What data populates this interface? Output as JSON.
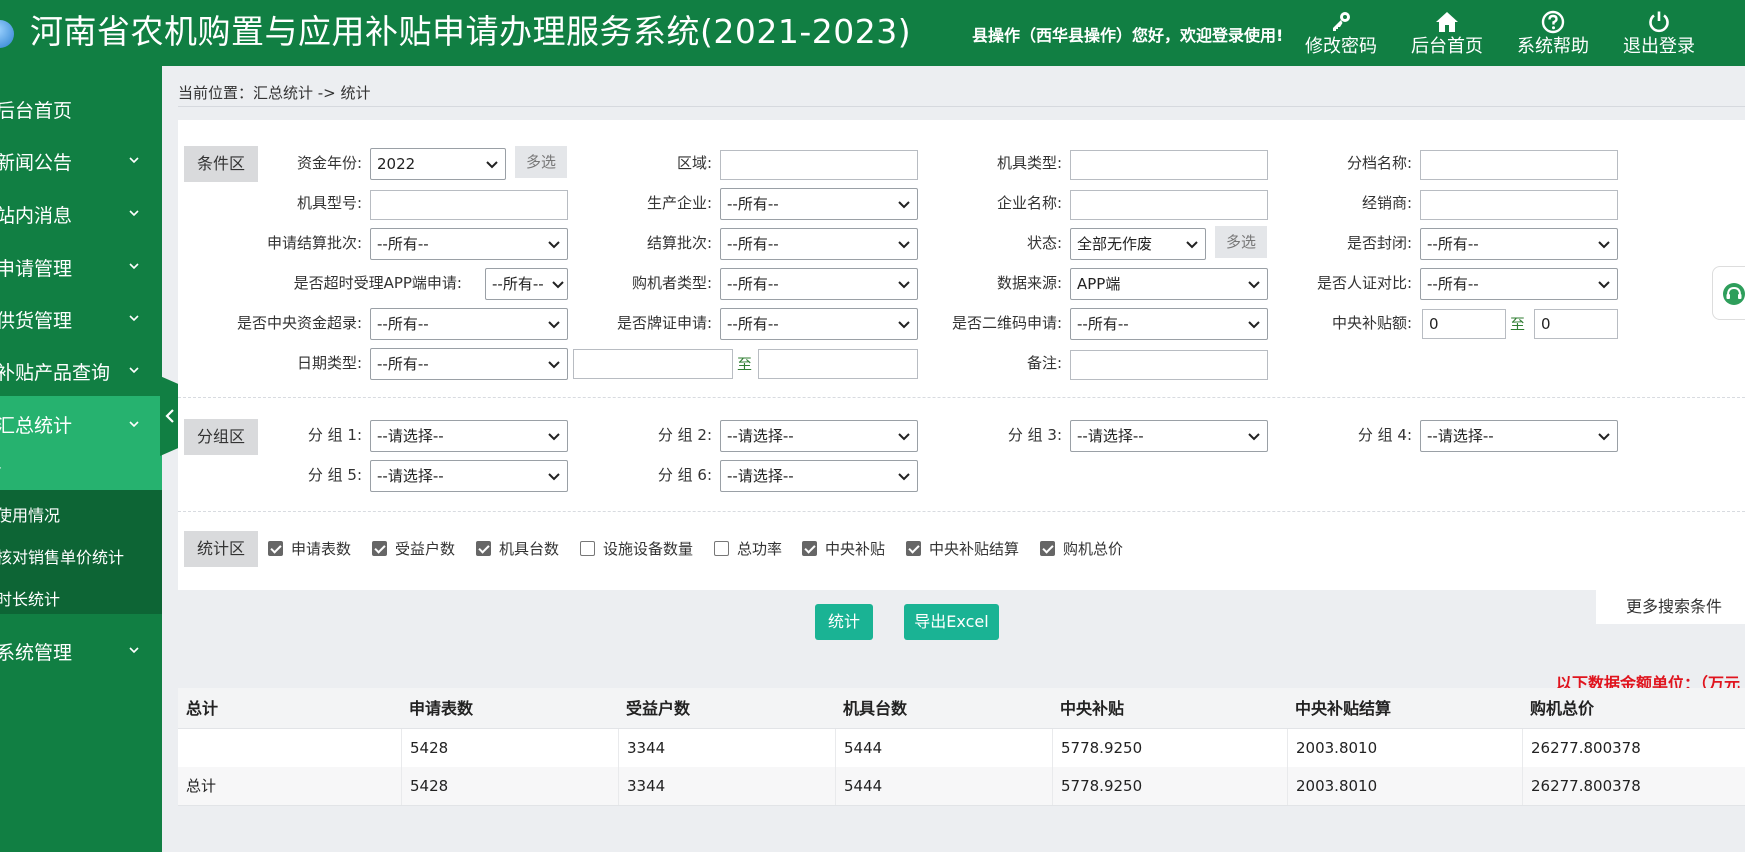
{
  "header": {
    "title": "河南省农机购置与应用补贴申请办理服务系统(2021-2023)",
    "welcome": "县操作（西华县操作）您好，欢迎登录使用!",
    "buttons": [
      {
        "label": "修改密码",
        "icon": "key-icon"
      },
      {
        "label": "后台首页",
        "icon": "home-icon"
      },
      {
        "label": "系统帮助",
        "icon": "help-icon"
      },
      {
        "label": "退出登录",
        "icon": "power-icon"
      }
    ]
  },
  "sidebar": {
    "items": [
      {
        "label": "后台首页"
      },
      {
        "label": "新闻公告"
      },
      {
        "label": "站内消息"
      },
      {
        "label": "申请管理"
      },
      {
        "label": "供货管理"
      },
      {
        "label": "补贴产品查询"
      },
      {
        "label": "汇总统计"
      },
      {
        "label": "系统管理"
      }
    ],
    "submenu": [
      "-",
      "使用情况",
      "核对销售单价统计",
      "时长统计"
    ]
  },
  "breadcrumb": "当前位置：汇总统计 -> 统计",
  "condition": {
    "tag": "条件区",
    "multi_label": "多选",
    "fields": {
      "fund_year": {
        "label": "资金年份:",
        "value": "2022"
      },
      "region": {
        "label": "区域:",
        "value": ""
      },
      "machine_type": {
        "label": "机具类型:",
        "value": ""
      },
      "tier_name": {
        "label": "分档名称:",
        "value": ""
      },
      "model": {
        "label": "机具型号:",
        "value": ""
      },
      "manufacturer": {
        "label": "生产企业:",
        "value": "--所有--"
      },
      "company_name": {
        "label": "企业名称:",
        "value": ""
      },
      "dealer": {
        "label": "经销商:",
        "value": ""
      },
      "apply_batch": {
        "label": "申请结算批次:",
        "value": "--所有--"
      },
      "settle_batch": {
        "label": "结算批次:",
        "value": "--所有--"
      },
      "status": {
        "label": "状态:",
        "value": "全部无作废"
      },
      "closed": {
        "label": "是否封闭:",
        "value": "--所有--"
      },
      "overtime_app": {
        "label": "是否超时受理APP端申请:",
        "value": "--所有--"
      },
      "buyer_type": {
        "label": "购机者类型:",
        "value": "--所有--"
      },
      "data_source": {
        "label": "数据来源:",
        "value": "APP端"
      },
      "face_compare": {
        "label": "是否人证对比:",
        "value": "--所有--"
      },
      "central_over": {
        "label": "是否中央资金超录:",
        "value": "--所有--"
      },
      "plate_apply": {
        "label": "是否牌证申请:",
        "value": "--所有--"
      },
      "qr_apply": {
        "label": "是否二维码申请:",
        "value": "--所有--"
      },
      "central_amount": {
        "label": "中央补贴额:",
        "from": "0",
        "to": "0"
      },
      "date_type": {
        "label": "日期类型:",
        "value": "--所有--"
      },
      "remark": {
        "label": "备注:",
        "value": ""
      }
    },
    "to_label": "至"
  },
  "group": {
    "tag": "分组区",
    "items": [
      {
        "label": "分 组 1:",
        "value": "--请选择--"
      },
      {
        "label": "分 组 2:",
        "value": "--请选择--"
      },
      {
        "label": "分 组 3:",
        "value": "--请选择--"
      },
      {
        "label": "分 组 4:",
        "value": "--请选择--"
      },
      {
        "label": "分 组 5:",
        "value": "--请选择--"
      },
      {
        "label": "分 组 6:",
        "value": "--请选择--"
      }
    ]
  },
  "stats": {
    "tag": "统计区",
    "checks": [
      {
        "label": "申请表数",
        "checked": true
      },
      {
        "label": "受益户数",
        "checked": true
      },
      {
        "label": "机具台数",
        "checked": true
      },
      {
        "label": "设施设备数量",
        "checked": false
      },
      {
        "label": "总功率",
        "checked": false
      },
      {
        "label": "中央补贴",
        "checked": true
      },
      {
        "label": "中央补贴结算",
        "checked": true
      },
      {
        "label": "购机总价",
        "checked": true
      }
    ]
  },
  "more_search": "更多搜索条件",
  "actions": {
    "stat": "统计",
    "export": "导出Excel"
  },
  "unit_note": "以下数据金额单位：（万元",
  "table": {
    "headers": [
      "总计",
      "申请表数",
      "受益户数",
      "机具台数",
      "中央补贴",
      "中央补贴结算",
      "购机总价"
    ],
    "rows": [
      [
        "",
        "5428",
        "3344",
        "5444",
        "5778.9250",
        "2003.8010",
        "26277.800378"
      ],
      [
        "总计",
        "5428",
        "3344",
        "5444",
        "5778.9250",
        "2003.8010",
        "26277.800378"
      ]
    ]
  },
  "colors": {
    "brand": "#117f43",
    "active": "#26b26f",
    "button": "#1ab394",
    "alert": "#e0141e"
  }
}
